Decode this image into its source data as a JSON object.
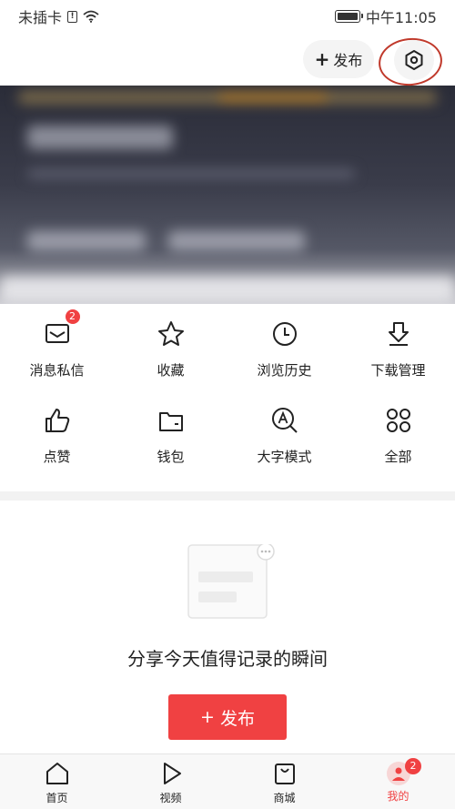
{
  "status_bar": {
    "carrier": "未插卡",
    "time": "中午11:05",
    "battery_level": 1.0
  },
  "header": {
    "publish_label": "发布",
    "settings_icon": "settings-hexagon-icon"
  },
  "grid": {
    "items": [
      {
        "label": "消息私信",
        "icon": "message-icon",
        "badge": "2"
      },
      {
        "label": "收藏",
        "icon": "star-icon"
      },
      {
        "label": "浏览历史",
        "icon": "clock-icon"
      },
      {
        "label": "下载管理",
        "icon": "download-icon"
      },
      {
        "label": "点赞",
        "icon": "thumbs-up-icon"
      },
      {
        "label": "钱包",
        "icon": "wallet-icon"
      },
      {
        "label": "大字模式",
        "icon": "large-text-icon"
      },
      {
        "label": "全部",
        "icon": "grid-icon"
      }
    ]
  },
  "empty_state": {
    "text": "分享今天值得记录的瞬间",
    "button_label": "发布"
  },
  "bottom_nav": {
    "items": [
      {
        "label": "首页",
        "icon": "home-icon"
      },
      {
        "label": "视频",
        "icon": "play-icon"
      },
      {
        "label": "商城",
        "icon": "shopping-bag-icon"
      },
      {
        "label": "我的",
        "icon": "mine-icon",
        "badge": "2",
        "active": true
      }
    ]
  },
  "colors": {
    "accent": "#f04142",
    "highlight_ring": "#c0392b"
  }
}
